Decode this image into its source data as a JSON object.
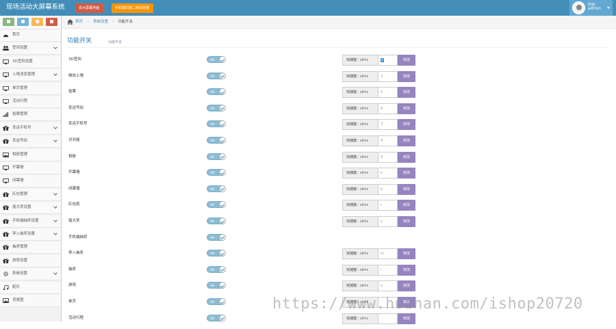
{
  "header": {
    "brand": "现场活动大屏幕系统",
    "btn_big_screen": "去大屏幕界面",
    "btn_qr": "手机端扫描二维码登录",
    "user_greeting": "欢迎,",
    "user_name": "admin",
    "colors": {
      "bar": "#438eb9",
      "user": "#62a8d1"
    }
  },
  "shortcuts": [
    {
      "icon": "signal-icon",
      "color": "#87b87f"
    },
    {
      "icon": "pencil-icon",
      "color": "#6fb3e0"
    },
    {
      "icon": "users-icon",
      "color": "#ffb752"
    },
    {
      "icon": "cogs-icon",
      "color": "#d15b47"
    }
  ],
  "sidebar": {
    "items": [
      {
        "label": "首页",
        "icon": "dashboard-icon",
        "arrow": false
      },
      {
        "label": "签到设置",
        "icon": "users-icon",
        "arrow": true
      },
      {
        "label": "3D签到设置",
        "icon": "desktop-icon",
        "arrow": false
      },
      {
        "label": "上墙消息管理",
        "icon": "desktop-icon",
        "arrow": true
      },
      {
        "label": "单页管理",
        "icon": "desktop-icon",
        "arrow": false
      },
      {
        "label": "活动行程",
        "icon": "desktop-icon",
        "arrow": false
      },
      {
        "label": "投票管理",
        "icon": "bar-chart-icon",
        "arrow": false
      },
      {
        "label": "幸运手机号",
        "icon": "gift-icon",
        "arrow": true
      },
      {
        "label": "幸运号码",
        "icon": "gift-icon",
        "arrow": true
      },
      {
        "label": "相册管理",
        "icon": "picture-icon",
        "arrow": false
      },
      {
        "label": "开幕墙",
        "icon": "desktop-icon",
        "arrow": false
      },
      {
        "label": "闭幕墙",
        "icon": "desktop-icon",
        "arrow": false
      },
      {
        "label": "红包管理",
        "icon": "gift-icon",
        "arrow": true
      },
      {
        "label": "摇大奖设置",
        "icon": "gift-icon",
        "arrow": true
      },
      {
        "label": "手机端抽奖设置",
        "icon": "gift-icon",
        "arrow": true
      },
      {
        "label": "导入抽奖设置",
        "icon": "gift-icon",
        "arrow": true
      },
      {
        "label": "抽奖管理",
        "icon": "gift-icon",
        "arrow": false
      },
      {
        "label": "游戏设置",
        "icon": "gift-icon",
        "arrow": false
      },
      {
        "label": "系统设置",
        "icon": "cog-icon",
        "arrow": true
      },
      {
        "label": "配乐",
        "icon": "music-icon",
        "arrow": false
      },
      {
        "label": "背景图",
        "icon": "picture-icon",
        "arrow": false
      }
    ]
  },
  "breadcrumb": {
    "home": "首页",
    "section": "系统设置",
    "current": "功能开关"
  },
  "page": {
    "title": "功能开关",
    "subtitle": "功能开关"
  },
  "hotkey_prefix": "快捷键：ctrl+",
  "modify_label": "修改",
  "toggle_label": "ON",
  "features": [
    {
      "label": "3D签到",
      "key": "z",
      "hotkey": true,
      "selected": true
    },
    {
      "label": "微信上墙",
      "key": "3",
      "hotkey": true
    },
    {
      "label": "投票",
      "key": "5",
      "hotkey": true
    },
    {
      "label": "幸运号码",
      "key": "6",
      "hotkey": true
    },
    {
      "label": "幸运手机号",
      "key": "7",
      "hotkey": true
    },
    {
      "label": "对对碰",
      "key": "8",
      "hotkey": true
    },
    {
      "label": "相册",
      "key": "9",
      "hotkey": true
    },
    {
      "label": "开幕墙",
      "key": "k",
      "hotkey": true
    },
    {
      "label": "闭幕墙",
      "key": "b",
      "hotkey": true
    },
    {
      "label": "红包雨",
      "key": "r",
      "hotkey": true
    },
    {
      "label": "摇大奖",
      "key": "y",
      "hotkey": true
    },
    {
      "label": "手机端抽奖",
      "key": "",
      "hotkey": false
    },
    {
      "label": "导入抽奖",
      "key": "m",
      "hotkey": true
    },
    {
      "label": "抽奖",
      "key": "l",
      "hotkey": true
    },
    {
      "label": "游戏",
      "key": "x",
      "hotkey": true
    },
    {
      "label": "单页",
      "key": "",
      "hotkey": true
    },
    {
      "label": "活动行程",
      "key": "",
      "hotkey": true
    }
  ],
  "watermark": "https://www.huzhan.com/ishop20720"
}
